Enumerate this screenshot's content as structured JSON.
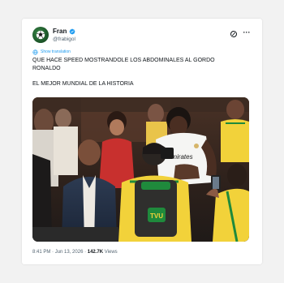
{
  "tweet": {
    "author": {
      "display_name": "Fran",
      "handle": "@frabigol",
      "verified": true,
      "avatar_icon": "soccer-avatar-icon"
    },
    "actions": {
      "grok_icon": "grok-icon",
      "more_icon": "more-icon",
      "more_label": "···"
    },
    "translate_label": "Show translation",
    "text_lines": [
      "QUE HACE SPEED MOSTRANDOLE LOS ABDOMINALES AL GORDO",
      "RONALDO",
      "EL MEJOR MUNDIAL DE LA HISTORIA"
    ],
    "media": {
      "shirt_text": "Emirates",
      "tv_logo_text": "TVU"
    },
    "meta": {
      "time": "8:41 PM",
      "separator": "·",
      "date": "Jun 13, 2026",
      "views_count": "142.7K",
      "views_label": "Views"
    },
    "colors": {
      "link_blue": "#1d9bf0",
      "text_primary": "#0f1419",
      "text_secondary": "#536471",
      "brazil_yellow": "#f5d90a",
      "brazil_green": "#1f8a3c"
    }
  }
}
